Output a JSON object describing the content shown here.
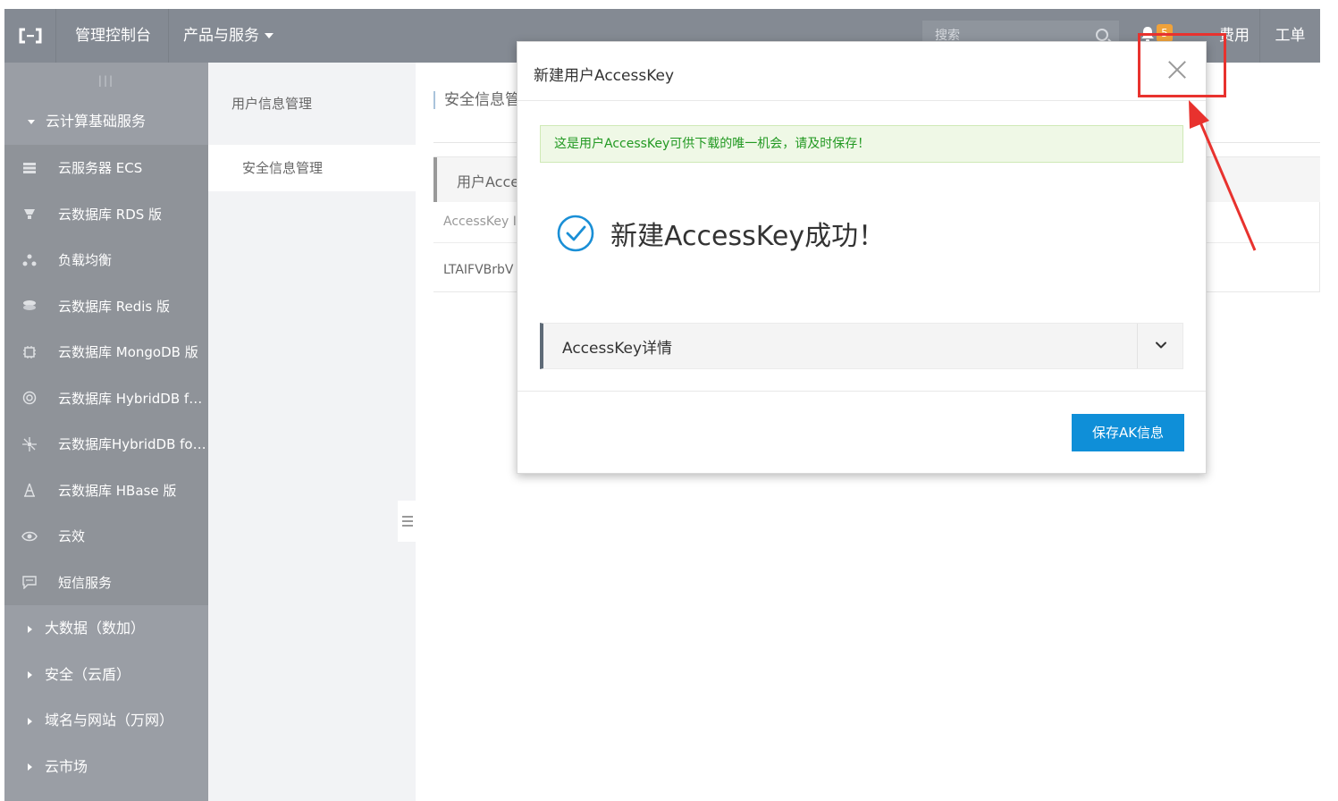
{
  "topbar": {
    "logo_icon": "aliyun-logo-icon",
    "console_label": "管理控制台",
    "products_label": "产品与服务",
    "search_placeholder": "搜索",
    "notification_count": "5",
    "fee_label": "费用",
    "ticket_label": "工单"
  },
  "sidebar": {
    "handle": "|||",
    "group_label": "云计算基础服务",
    "items": [
      {
        "label": "云服务器 ECS",
        "icon": "server-icon"
      },
      {
        "label": "云数据库 RDS 版",
        "icon": "database-icon"
      },
      {
        "label": "负载均衡",
        "icon": "load-balancer-icon"
      },
      {
        "label": "云数据库 Redis 版",
        "icon": "redis-icon"
      },
      {
        "label": "云数据库 MongoDB 版",
        "icon": "mongodb-icon"
      },
      {
        "label": "云数据库 HybridDB fo...",
        "icon": "hybriddb-icon"
      },
      {
        "label": "云数据库HybridDB for...",
        "icon": "hybriddb-cluster-icon"
      },
      {
        "label": "云数据库 HBase 版",
        "icon": "hbase-icon"
      },
      {
        "label": "云效",
        "icon": "eye-icon"
      },
      {
        "label": "短信服务",
        "icon": "message-icon"
      }
    ],
    "collapsed_groups": [
      {
        "label": "大数据（数加）"
      },
      {
        "label": "安全（云盾）"
      },
      {
        "label": "域名与网站（万网）"
      },
      {
        "label": "云市场"
      }
    ]
  },
  "subnav": {
    "title": "用户信息管理",
    "active_item": "安全信息管理"
  },
  "content": {
    "breadcrumb": "安全信息管",
    "panel_title": "用户Acce",
    "column_header": "AccessKey I",
    "row_value": "LTAIFVBrbV"
  },
  "modal": {
    "title": "新建用户AccessKey",
    "notice": "这是用户AccessKey可供下载的唯一机会，请及时保存！",
    "success_text": "新建AccessKey成功！",
    "details_label": "AccessKey详情",
    "save_button": "保存AK信息"
  },
  "colors": {
    "topbar": "#848a93",
    "sidebar": "#9a9ea5",
    "primary_button": "#0f8fd8",
    "success": "#1a8fd6",
    "notice_text": "#229922",
    "annotation": "#e8322e"
  }
}
